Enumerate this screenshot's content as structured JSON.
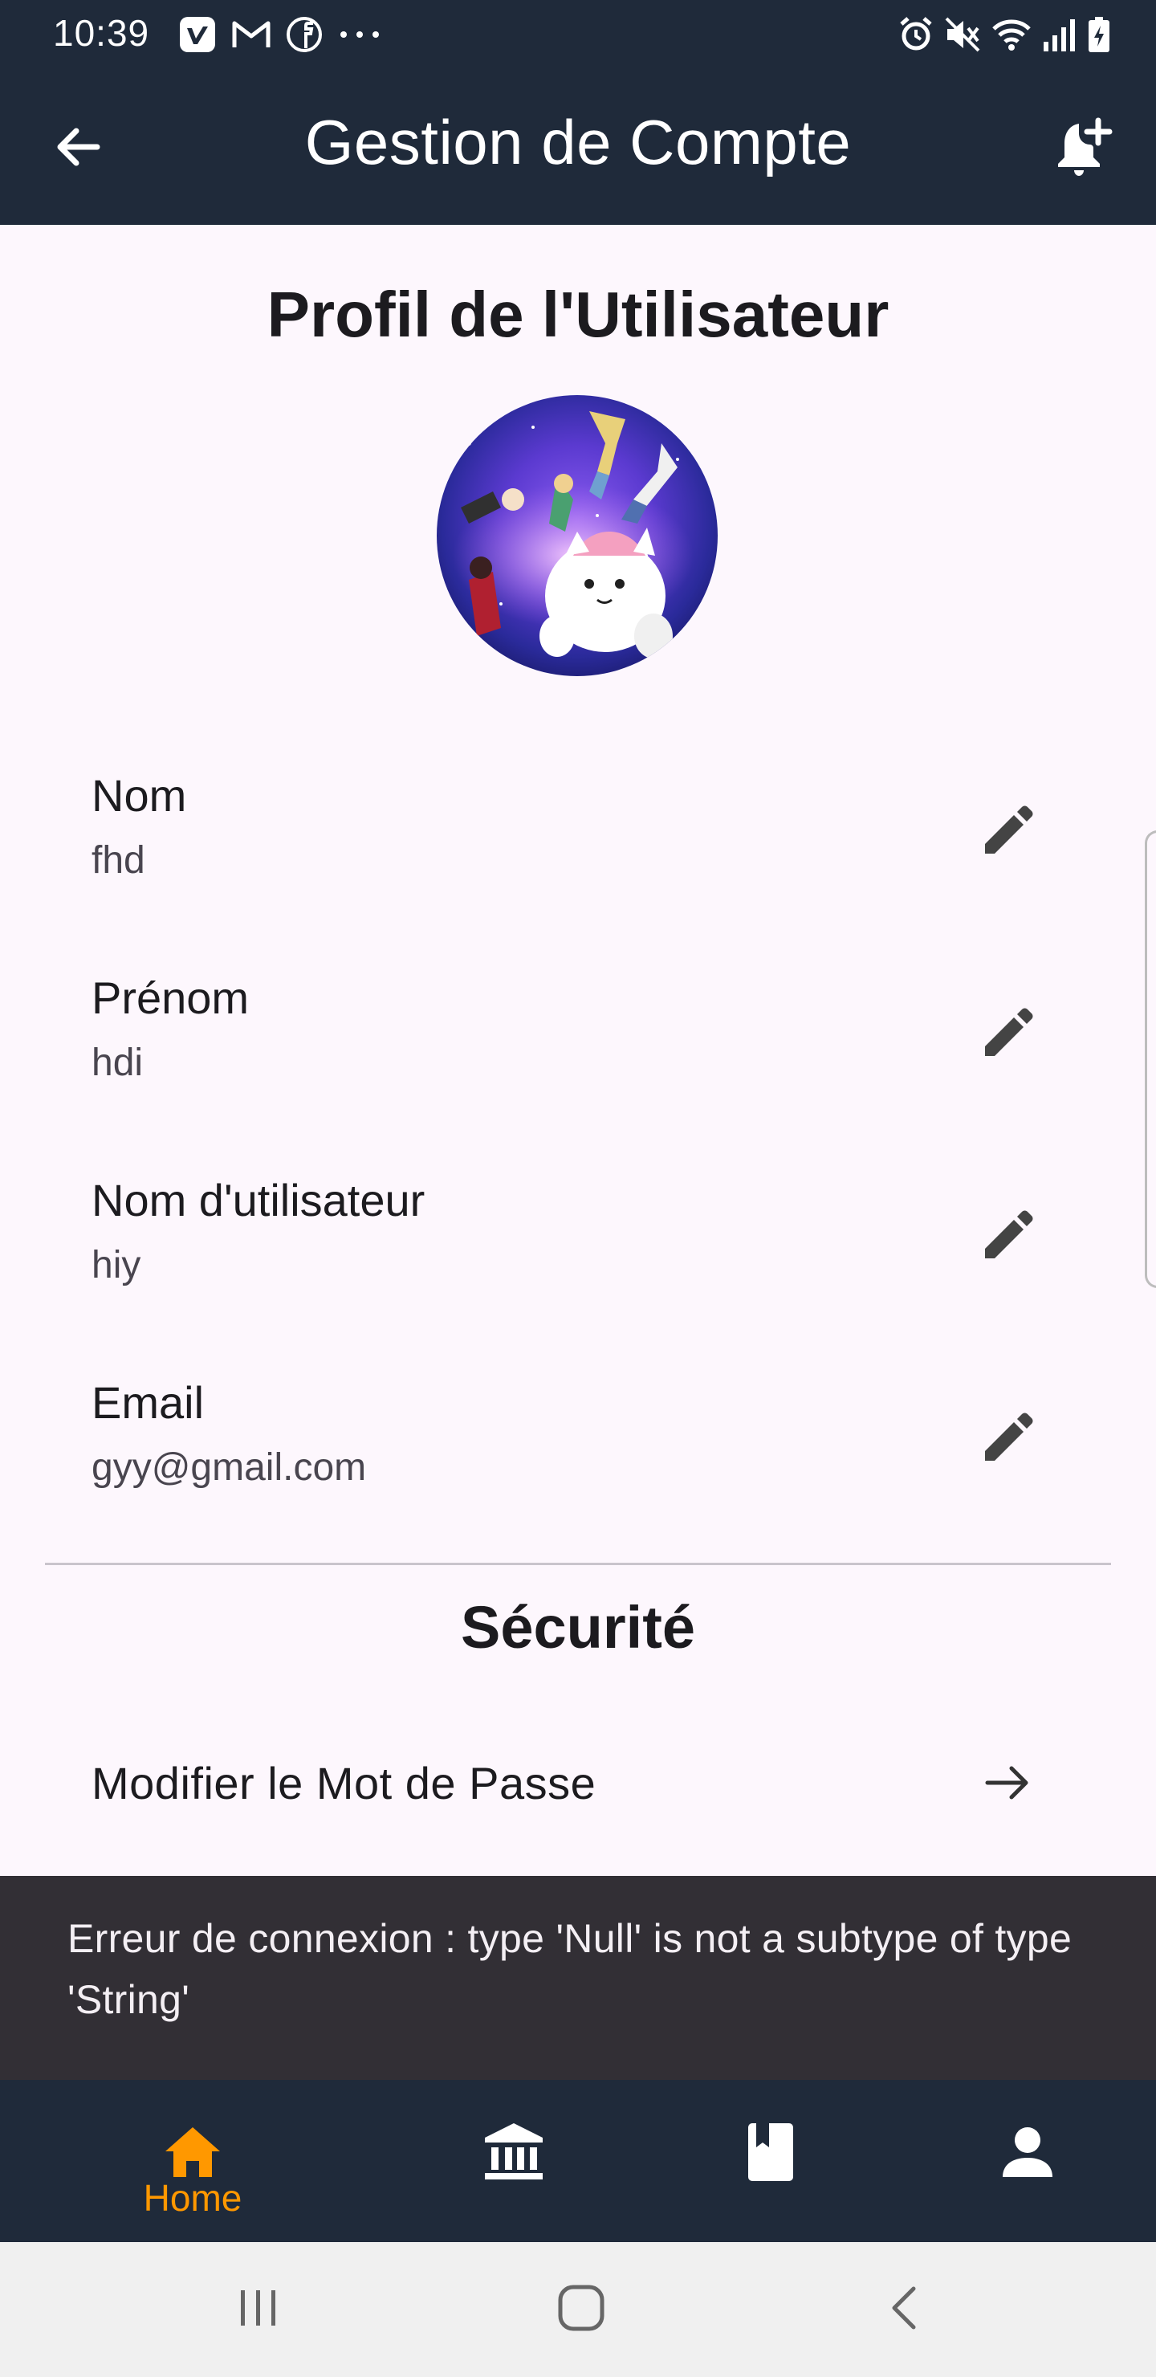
{
  "status_bar": {
    "time": "10:39",
    "left_icons": [
      "vimeo-icon",
      "gmail-icon",
      "facebook-icon",
      "more-dots-icon"
    ],
    "right_icons": [
      "alarm-icon",
      "mute-icon",
      "wifi-icon",
      "signal-icon",
      "battery-charging-icon"
    ]
  },
  "app_bar": {
    "title": "Gestion de Compte",
    "back_icon": "arrow-left-icon",
    "action_icon": "bell-plus-icon"
  },
  "profile": {
    "title": "Profil de l'Utilisateur",
    "fields": [
      {
        "label": "Nom",
        "value": "fhd"
      },
      {
        "label": "Prénom",
        "value": "hdi"
      },
      {
        "label": "Nom d'utilisateur",
        "value": "hiy"
      },
      {
        "label": "Email",
        "value": "gyy@gmail.com"
      }
    ]
  },
  "security": {
    "title": "Sécurité",
    "change_password_label": "Modifier le Mot de Passe"
  },
  "snackbar": {
    "message": "Erreur de connexion : type 'Null' is not a subtype of type 'String'"
  },
  "bottom_nav": {
    "items": [
      {
        "icon": "home-icon",
        "label": "Home",
        "active": true
      },
      {
        "icon": "bank-icon",
        "label": "",
        "active": false
      },
      {
        "icon": "book-icon",
        "label": "",
        "active": false
      },
      {
        "icon": "person-icon",
        "label": "",
        "active": false
      }
    ],
    "active_color": "#ff9800"
  },
  "colors": {
    "app_bar": "#1f2a3a",
    "background": "#fdf7fd",
    "snackbar": "#322f35",
    "accent": "#ff9800"
  }
}
